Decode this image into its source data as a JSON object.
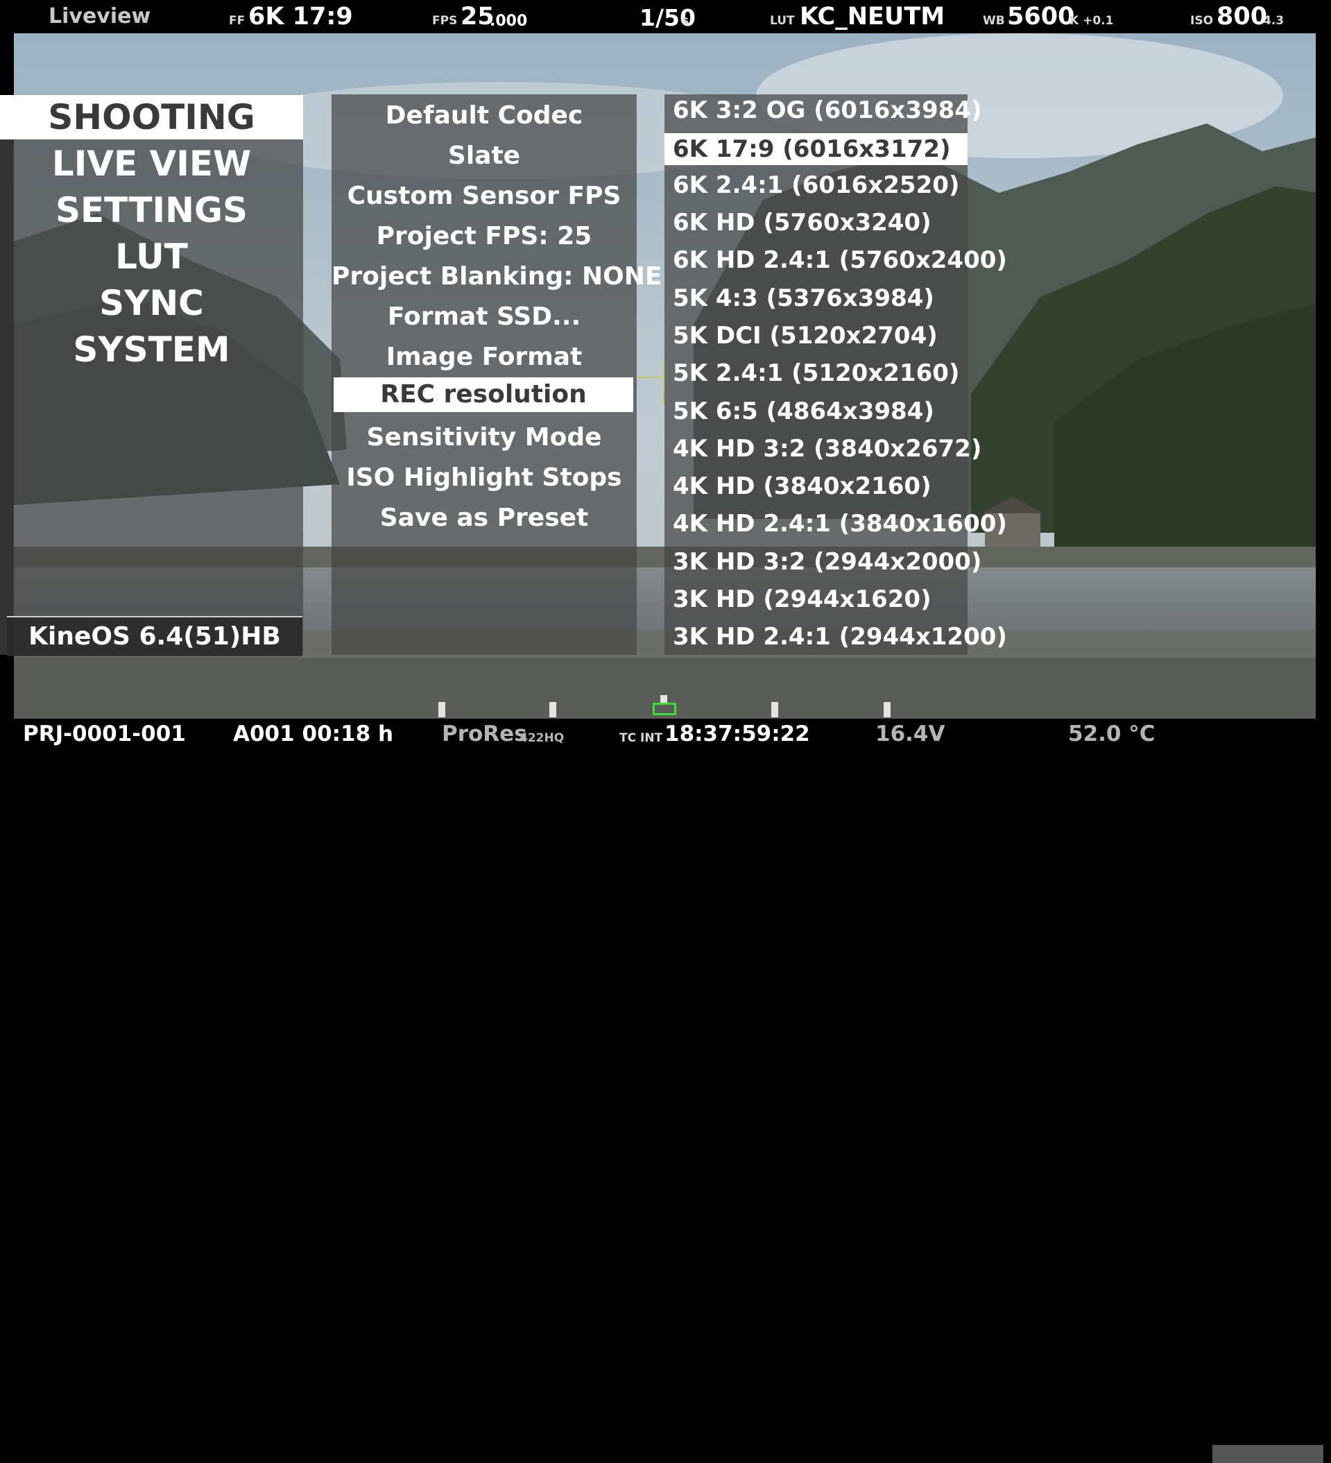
{
  "topbar": {
    "mode": "Liveview",
    "format_prefix": "FF",
    "format_value": "6K 17:9",
    "fps_prefix": "FPS",
    "fps_value": "25",
    "fps_decimal": ".000",
    "shutter_value": "1/50",
    "shutter_unit": "s",
    "lut_prefix": "LUT",
    "lut_value": "KC_NEUTM",
    "wb_prefix": "WB",
    "wb_value": "5600",
    "wb_suffix": "K +0.1",
    "iso_prefix": "ISO",
    "iso_value": "800",
    "iso_suffix": "4.3"
  },
  "categories": [
    {
      "label": "SHOOTING",
      "selected": true
    },
    {
      "label": "LIVE VIEW",
      "selected": false
    },
    {
      "label": "SETTINGS",
      "selected": false
    },
    {
      "label": "LUT",
      "selected": false
    },
    {
      "label": "SYNC",
      "selected": false
    },
    {
      "label": "SYSTEM",
      "selected": false
    }
  ],
  "version": "KineOS 6.4(51)HB",
  "options": [
    {
      "label": "Default Codec",
      "selected": false
    },
    {
      "label": "Slate",
      "selected": false
    },
    {
      "label": "Custom Sensor FPS",
      "selected": false
    },
    {
      "label": "Project FPS: 25",
      "selected": false
    },
    {
      "label": "Project Blanking: NONE",
      "selected": false
    },
    {
      "label": "Format SSD...",
      "selected": false
    },
    {
      "label": "Image Format",
      "selected": false
    },
    {
      "label": "REC resolution",
      "selected": true
    },
    {
      "label": "Sensitivity Mode",
      "selected": false
    },
    {
      "label": "ISO Highlight Stops",
      "selected": false
    },
    {
      "label": "Save as Preset",
      "selected": false
    }
  ],
  "resolutions": [
    {
      "label": "6K 3:2 OG (6016x3984)",
      "selected": false
    },
    {
      "label": "6K 17:9 (6016x3172)",
      "selected": true
    },
    {
      "label": "6K 2.4:1 (6016x2520)",
      "selected": false
    },
    {
      "label": "6K HD (5760x3240)",
      "selected": false
    },
    {
      "label": "6K HD 2.4:1 (5760x2400)",
      "selected": false
    },
    {
      "label": "5K 4:3 (5376x3984)",
      "selected": false
    },
    {
      "label": "5K DCI (5120x2704)",
      "selected": false
    },
    {
      "label": "5K 2.4:1 (5120x2160)",
      "selected": false
    },
    {
      "label": "5K 6:5 (4864x3984)",
      "selected": false
    },
    {
      "label": "4K HD 3:2 (3840x2672)",
      "selected": false
    },
    {
      "label": "4K HD (3840x2160)",
      "selected": false
    },
    {
      "label": "4K HD 2.4:1 (3840x1600)",
      "selected": false
    },
    {
      "label": "3K HD 3:2 (2944x2000)",
      "selected": false
    },
    {
      "label": "3K HD (2944x1620)",
      "selected": false
    },
    {
      "label": "3K HD 2.4:1 (2944x1200)",
      "selected": false
    }
  ],
  "bottombar": {
    "project": "PRJ-0001-001",
    "clip": "A001 00:18 h",
    "codec": "ProRes",
    "codec_sub": "422HQ",
    "tc_prefix": "TC INT",
    "timecode": "18:37:59:22",
    "voltage": "16.4V",
    "temperature": "52.0 °C"
  },
  "colors": {
    "selected_bg": "#ffffff",
    "panel_bg": "#464646",
    "indicator_green": "#39e03a"
  }
}
